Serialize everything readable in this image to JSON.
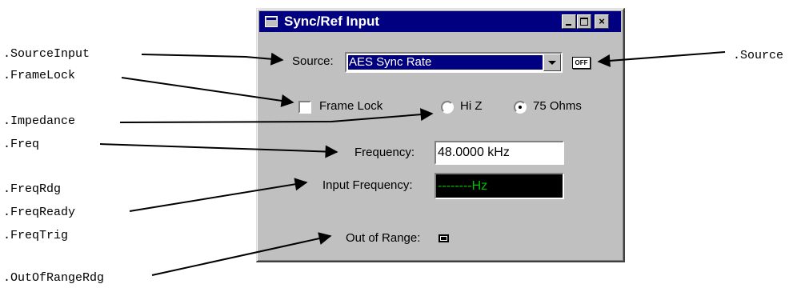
{
  "window": {
    "title": "Sync/Ref Input",
    "close_glyph": "×"
  },
  "source": {
    "label": "Source:",
    "selected": "AES Sync Rate",
    "off_button": "OFF"
  },
  "frame_lock": {
    "label": "Frame Lock",
    "checked": false
  },
  "impedance": {
    "options": [
      {
        "label": "Hi Z",
        "checked": false
      },
      {
        "label": "75 Ohms",
        "checked": true
      }
    ]
  },
  "frequency": {
    "label": "Frequency:",
    "value": "48.0000 kHz"
  },
  "input_frequency": {
    "label": "Input Frequency:",
    "reading": "--------Hz"
  },
  "out_of_range": {
    "label": "Out of Range:"
  },
  "callouts": {
    "source_input": ".SourceInput",
    "frame_lock": ".FrameLock",
    "impedance": ".Impedance",
    "freq": ".Freq",
    "freq_rdg": ".FreqRdg",
    "freq_ready": ".FreqReady",
    "freq_trig": ".FreqTrig",
    "out_of_range_rdg": ".OutOfRangeRdg",
    "source": ".Source"
  },
  "colors": {
    "title_bar": "#000080",
    "dialog_face": "#c0c0c0",
    "reading_text": "#00c000"
  }
}
